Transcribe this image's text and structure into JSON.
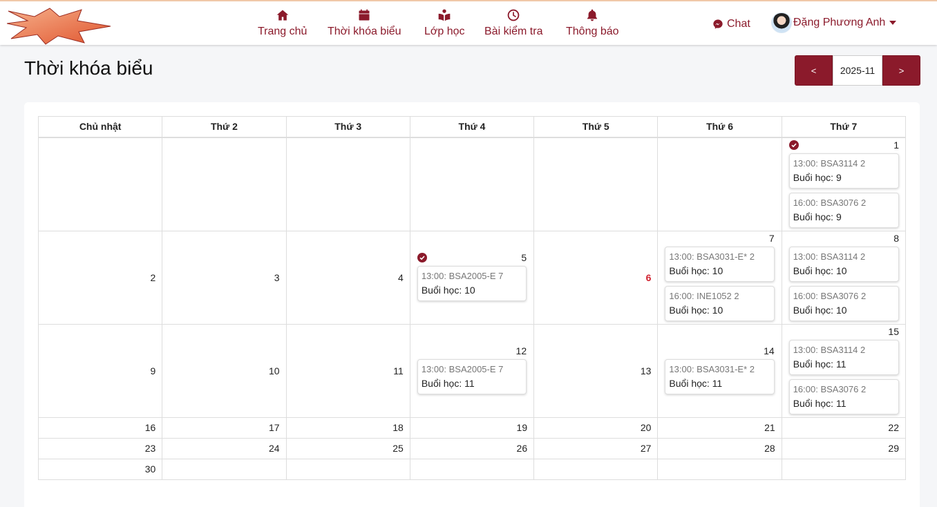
{
  "nav": [
    {
      "label": "Trang chủ",
      "icon": "home-icon"
    },
    {
      "label": "Thời khóa biểu",
      "icon": "calendar-icon"
    },
    {
      "label": "Lớp học",
      "icon": "book-reader-icon"
    },
    {
      "label": "Bài kiểm tra",
      "icon": "clock-icon"
    },
    {
      "label": "Thông báo",
      "icon": "bell-icon"
    }
  ],
  "header": {
    "chat_label": "Chat",
    "user_name": "Đặng Phương Anh"
  },
  "page": {
    "title": "Thời khóa biểu",
    "prev_label": "<",
    "next_label": ">",
    "month_value": "2025-11"
  },
  "colors": {
    "accent": "#8b1a2b",
    "today": "#d0202e"
  },
  "calendar": {
    "weekdays": [
      "Chủ nhật",
      "Thứ 2",
      "Thứ 3",
      "Thứ 4",
      "Thứ 5",
      "Thứ 6",
      "Thứ 7"
    ],
    "days": {
      "d1": "1",
      "d2": "2",
      "d3": "3",
      "d4": "4",
      "d5": "5",
      "d6": "6",
      "d7": "7",
      "d8": "8",
      "d9": "9",
      "d10": "10",
      "d11": "11",
      "d12": "12",
      "d13": "13",
      "d14": "14",
      "d15": "15",
      "d16": "16",
      "d17": "17",
      "d18": "18",
      "d19": "19",
      "d20": "20",
      "d21": "21",
      "d22": "22",
      "d23": "23",
      "d24": "24",
      "d25": "25",
      "d26": "26",
      "d27": "27",
      "d28": "28",
      "d29": "29",
      "d30": "30"
    },
    "events": {
      "e1a": {
        "time": "13:00: BSA3114 2",
        "session": "Buổi học: 9"
      },
      "e1b": {
        "time": "16:00: BSA3076 2",
        "session": "Buổi học: 9"
      },
      "e5a": {
        "time": "13:00: BSA2005-E 7",
        "session": "Buổi học: 10"
      },
      "e7a": {
        "time": "13:00: BSA3031-E* 2",
        "session": "Buổi học: 10"
      },
      "e7b": {
        "time": "16:00: INE1052 2",
        "session": "Buổi học: 10"
      },
      "e8a": {
        "time": "13:00: BSA3114 2",
        "session": "Buổi học: 10"
      },
      "e8b": {
        "time": "16:00: BSA3076 2",
        "session": "Buổi học: 10"
      },
      "e12a": {
        "time": "13:00: BSA2005-E 7",
        "session": "Buổi học: 11"
      },
      "e14a": {
        "time": "13:00: BSA3031-E* 2",
        "session": "Buổi học: 11"
      },
      "e15a": {
        "time": "13:00: BSA3114 2",
        "session": "Buổi học: 11"
      },
      "e15b": {
        "time": "16:00: BSA3076 2",
        "session": "Buổi học: 11"
      }
    }
  }
}
